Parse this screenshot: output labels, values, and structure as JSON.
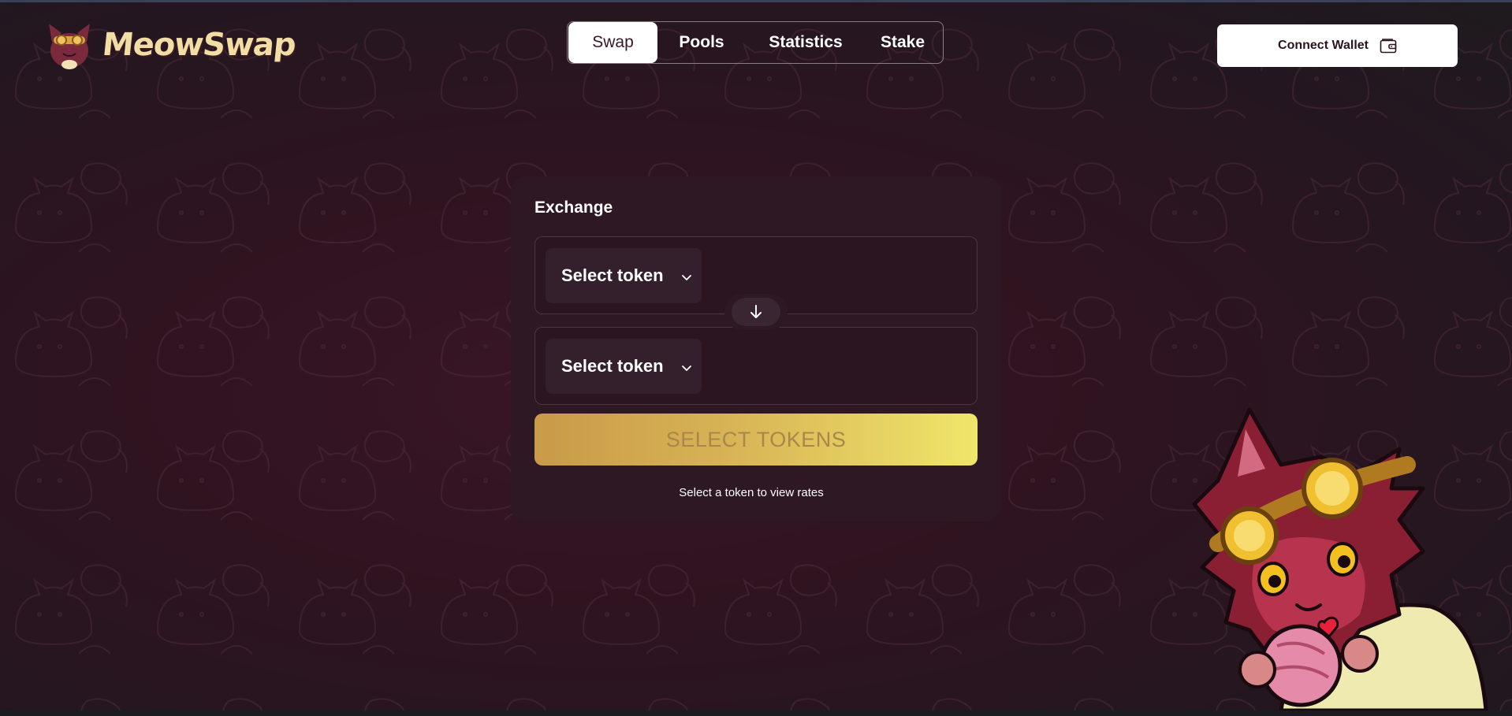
{
  "app": {
    "name": "MeowSwap",
    "brand_color": "#f2dda5",
    "background_color": "#2a1520",
    "accent_gradient": [
      "#c99a48",
      "#f0e66a"
    ]
  },
  "header": {
    "logo_text": "MeowSwap",
    "logo_icon": "cat-mascot-logo-icon",
    "nav_tabs": [
      {
        "label": "Swap",
        "active": true
      },
      {
        "label": "Pools",
        "active": false
      },
      {
        "label": "Statistics",
        "active": false
      },
      {
        "label": "Stake",
        "active": false
      }
    ],
    "connect_wallet": {
      "label": "Connect Wallet",
      "icon": "wallet-icon"
    }
  },
  "exchange": {
    "title": "Exchange",
    "from": {
      "select_label": "Select token",
      "icon": "chevron-down-icon"
    },
    "switch_icon": "arrow-down-icon",
    "to": {
      "select_label": "Select token",
      "icon": "chevron-down-icon"
    },
    "submit_label": "SELECT TOKENS",
    "rates_hint": "Select a token to view rates"
  },
  "decor": {
    "mascot": "goggles-cat-mascot-illustration",
    "pattern": "cat-doodle-background-pattern"
  }
}
